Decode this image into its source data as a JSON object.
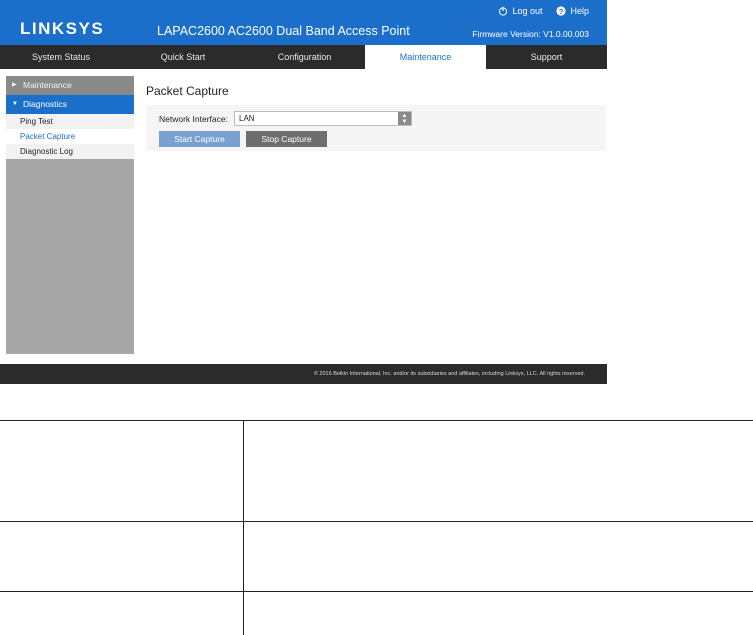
{
  "header": {
    "logo": "LINKSYS",
    "product_title": "LAPAC2600 AC2600 Dual Band Access Point",
    "logout_label": "Log out",
    "help_label": "Help",
    "firmware": "Firmware Version: V1.0.00.003"
  },
  "nav": {
    "tabs": [
      {
        "label": "System Status"
      },
      {
        "label": "Quick Start"
      },
      {
        "label": "Configuration"
      },
      {
        "label": "Maintenance"
      },
      {
        "label": "Support"
      }
    ],
    "active": "Maintenance"
  },
  "sidebar": {
    "groups": [
      {
        "label": "Maintenance"
      },
      {
        "label": "Diagnostics"
      }
    ],
    "items": [
      {
        "label": "Ping Test"
      },
      {
        "label": "Packet Capture"
      },
      {
        "label": "Diagnostic Log"
      }
    ],
    "active": "Packet Capture"
  },
  "content": {
    "title": "Packet Capture",
    "network_interface_label": "Network Interface:",
    "network_interface_value": "LAN",
    "start_label": "Start Capture",
    "stop_label": "Stop Capture"
  },
  "footer": {
    "copyright": "© 2016 Belkin International, Inc. and/or its subsidiaries and affiliates, including Linksys, LLC. All rights reserved."
  },
  "colors": {
    "brand_blue": "#1b6fcb",
    "nav_dark": "#2b2b2b",
    "sidebar_gray": "#a6a6a6"
  }
}
